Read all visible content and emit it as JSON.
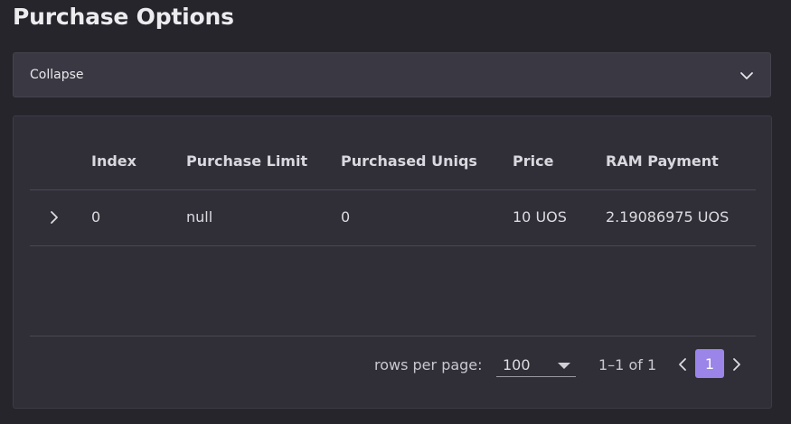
{
  "page_title": "Purchase Options",
  "collapse": {
    "label": "Collapse",
    "icon": "chevron-down-icon"
  },
  "table": {
    "columns": [
      "Index",
      "Purchase Limit",
      "Purchased Uniqs",
      "Price",
      "RAM Payment"
    ],
    "rows": [
      {
        "expand_icon": "chevron-right-icon",
        "index": "0",
        "purchase_limit": "null",
        "purchased_uniqs": "0",
        "price": "10 UOS",
        "ram_payment": "2.19086975 UOS"
      }
    ]
  },
  "pagination": {
    "rows_per_page_label": "rows per page:",
    "rows_per_page_value": "100",
    "range_text": "1–1 of 1",
    "current_page": "1",
    "prev_icon": "chevron-left-icon",
    "next_icon": "chevron-right-icon"
  },
  "colors": {
    "background": "#26252b",
    "card": "#302f38",
    "accent": "#9b85e8"
  }
}
